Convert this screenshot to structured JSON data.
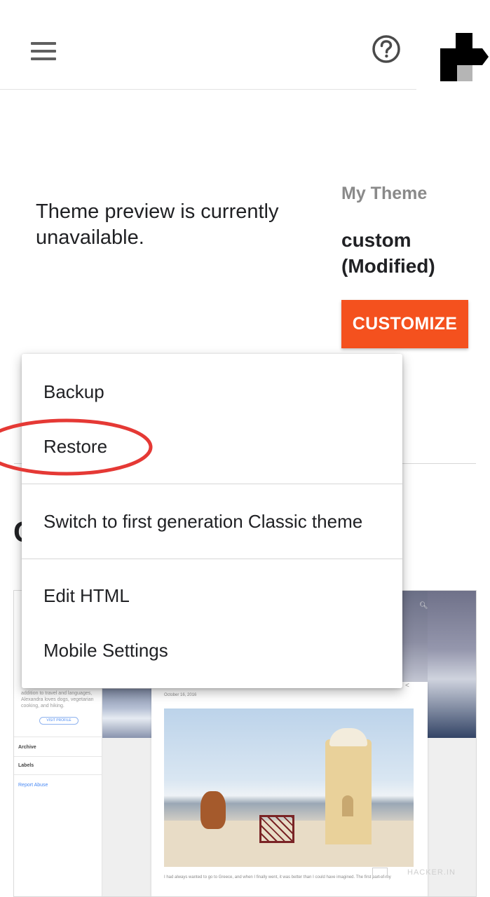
{
  "header": {
    "menu_icon": "hamburger-menu-icon",
    "help_icon": "help-circle-icon",
    "logo": "brand-logo"
  },
  "preview": {
    "message": "Theme preview is currently unavailable."
  },
  "theme_panel": {
    "label": "My Theme",
    "name": "custom (Modified)",
    "customize_label": "CUSTOMIZE",
    "accent_color": "#f4511e"
  },
  "gallery": {
    "heading_visible": "C"
  },
  "dropdown": {
    "items": [
      {
        "label": "Backup"
      },
      {
        "label": "Restore",
        "annotated": true
      },
      {
        "label": "Switch to first generation Classic theme"
      },
      {
        "label": "Edit HTML"
      },
      {
        "label": "Mobile Settings"
      }
    ]
  },
  "annotation": {
    "shape": "ellipse",
    "color": "#e53935",
    "target": "Restore"
  },
  "thumbnail": {
    "date": "October 16, 2016",
    "sidebar_rows": [
      "Archive",
      "Labels"
    ],
    "report_link": "Report Abuse",
    "visit_button": "VISIT PROFILE",
    "sidebar_text": "addition to travel and languages, Alexandra loves dogs, vegetarian cooking, and hiking.",
    "caption": "I had always wanted to go to Greece, and when I finally went, it was better than I could have imagined. The first part of my"
  },
  "watermark": {
    "text": "HACKER.IN"
  }
}
